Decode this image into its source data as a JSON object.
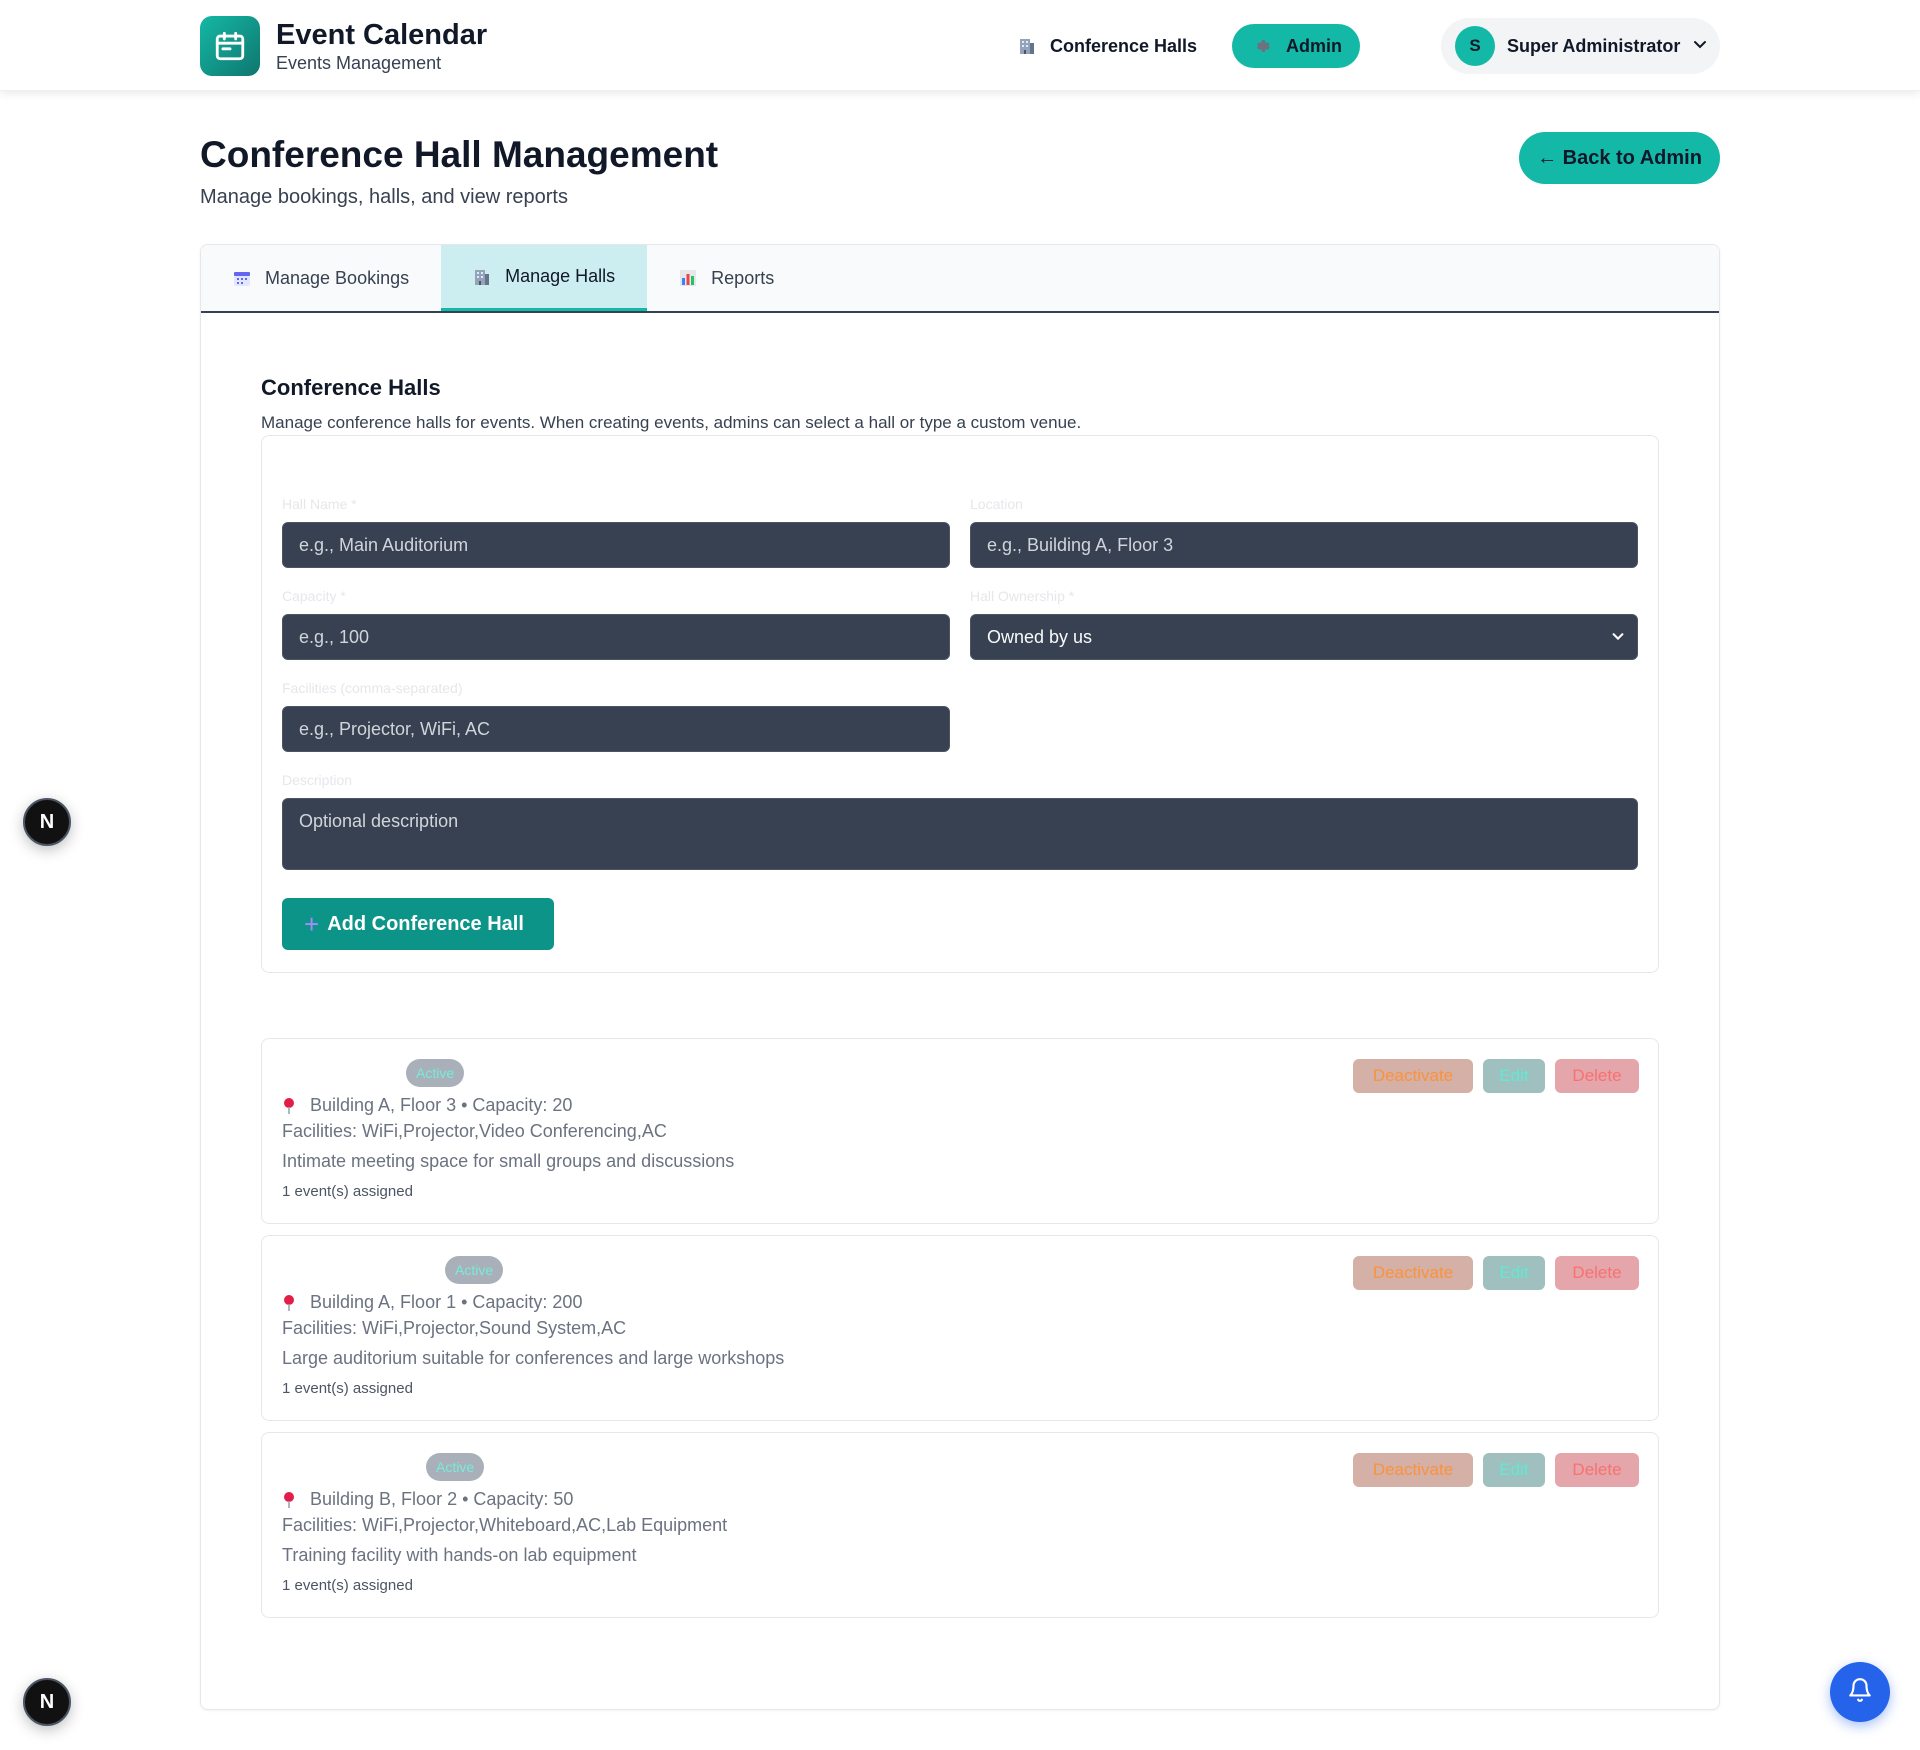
{
  "header": {
    "title": "Event Calendar",
    "subtitle": "Events Management",
    "logo_icon": "calendar-icon",
    "nav": {
      "halls_label": "Conference Halls",
      "admin_label": "Admin"
    },
    "user": {
      "initial": "S",
      "name": "Super Administrator"
    }
  },
  "page": {
    "title": "Conference Hall Management",
    "subtitle": "Manage bookings, halls, and view reports",
    "back_label": "← Back to Admin"
  },
  "tabs": [
    {
      "label": "Manage Bookings",
      "icon": "calendar-icon"
    },
    {
      "label": "Manage Halls",
      "icon": "building-icon",
      "active": true
    },
    {
      "label": "Reports",
      "icon": "bar-chart-icon"
    }
  ],
  "section": {
    "title": "Conference Halls",
    "subtitle": "Manage conference halls for events. When creating events, admins can select a hall or type a custom venue."
  },
  "form": {
    "hall_name": {
      "label": "Hall Name *",
      "placeholder": "e.g., Main Auditorium"
    },
    "location": {
      "label": "Location",
      "placeholder": "e.g., Building A, Floor 3"
    },
    "capacity": {
      "label": "Capacity *",
      "placeholder": "e.g., 100"
    },
    "ownership": {
      "label": "Hall Ownership *",
      "value": "Owned by us"
    },
    "facilities": {
      "label": "Facilities (comma-separated)",
      "placeholder": "e.g., Projector, WiFi, AC"
    },
    "description": {
      "label": "Description",
      "placeholder": "Optional description"
    },
    "submit_label": "Add Conference Hall"
  },
  "halls": [
    {
      "status": "Active",
      "meta": "Building A, Floor 3 • Capacity: 20",
      "facilities": "Facilities: WiFi,Projector,Video Conferencing,AC",
      "description": "Intimate meeting space for small groups and discussions",
      "assigned": "1 event(s) assigned"
    },
    {
      "status": "Active",
      "meta": "Building A, Floor 1 • Capacity: 200",
      "facilities": "Facilities: WiFi,Projector,Sound System,AC",
      "description": "Large auditorium suitable for conferences and large workshops",
      "assigned": "1 event(s) assigned"
    },
    {
      "status": "Active",
      "meta": "Building B, Floor 2 • Capacity: 50",
      "facilities": "Facilities: WiFi,Projector,Whiteboard,AC,Lab Equipment",
      "description": "Training facility with hands-on lab equipment",
      "assigned": "1 event(s) assigned"
    }
  ],
  "actions": {
    "deactivate": "Deactivate",
    "edit": "Edit",
    "delete": "Delete"
  },
  "floating": {
    "n_label": "N"
  },
  "colors": {
    "accent": "#14b8a6",
    "accent_dark": "#0d9488",
    "input_bg": "#374151",
    "bell_blue": "#2563eb"
  }
}
